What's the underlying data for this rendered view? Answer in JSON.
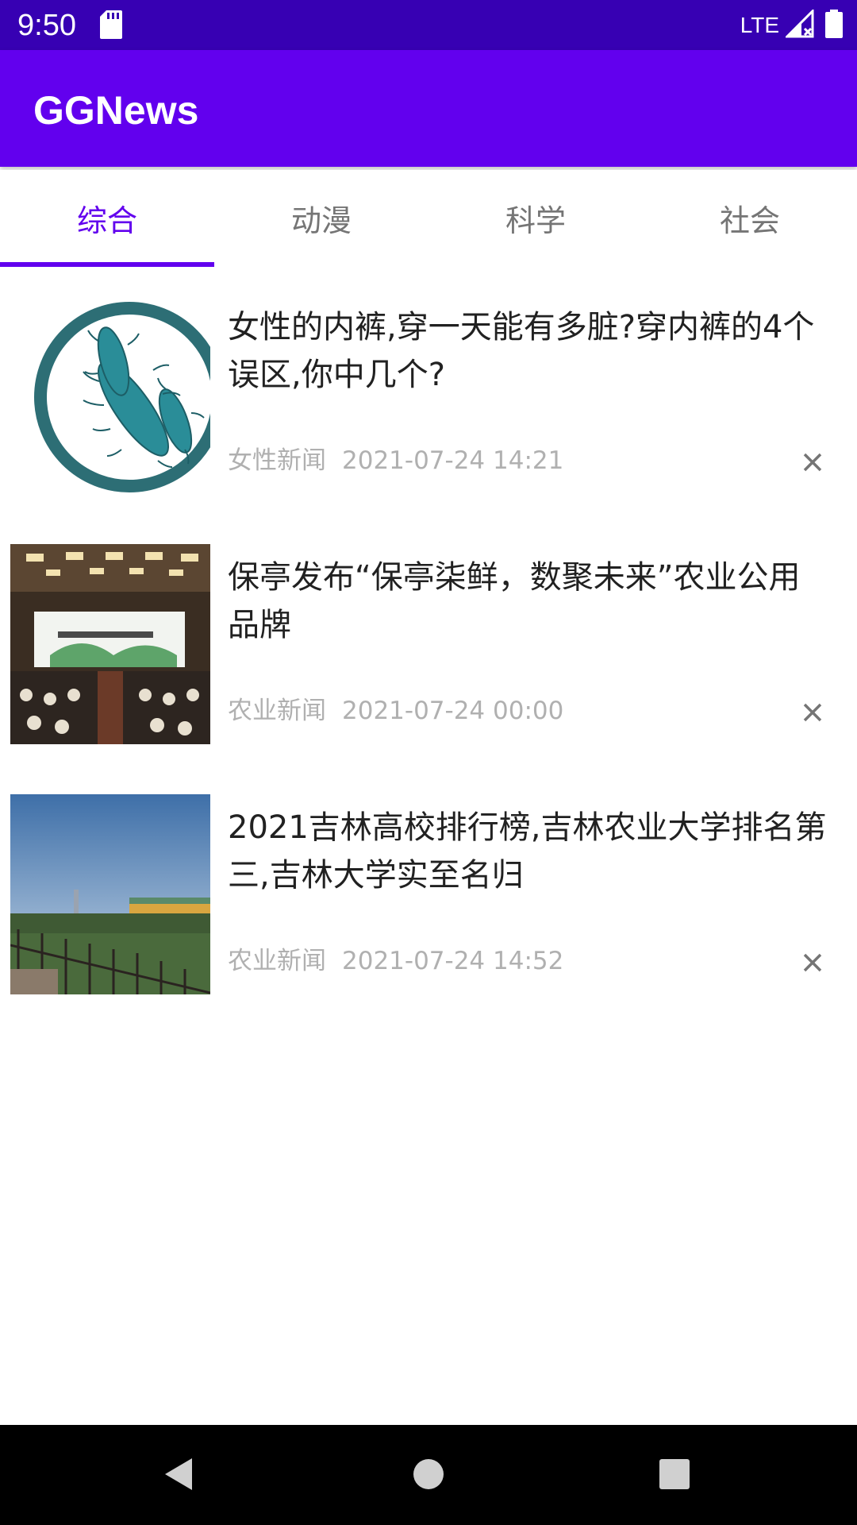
{
  "status_bar": {
    "time": "9:50",
    "network": "LTE",
    "icons": [
      "sd-card-icon",
      "signal-icon",
      "battery-icon"
    ]
  },
  "app_bar": {
    "title": "GGNews"
  },
  "tabs": [
    {
      "label": "综合",
      "active": true
    },
    {
      "label": "动漫",
      "active": false
    },
    {
      "label": "科学",
      "active": false
    },
    {
      "label": "社会",
      "active": false
    }
  ],
  "news": [
    {
      "title": "女性的内裤,穿一天能有多脏?穿内裤的4个误区,你中几个?",
      "source": "女性新闻",
      "time": "2021-07-24 14:21",
      "image": "bacteria-illustration"
    },
    {
      "title": "保亭发布“保亭柒鲜，数聚未来”农业公用品牌",
      "source": "农业新闻",
      "time": "2021-07-24 00:00",
      "image": "conference-hall-photo"
    },
    {
      "title": "2021吉林高校排行榜,吉林农业大学排名第三,吉林大学实至名归",
      "source": "农业新闻",
      "time": "2021-07-24 14:52",
      "image": "campus-photo"
    }
  ],
  "colors": {
    "status_bar": "#3700b3",
    "primary": "#6200ee",
    "tab_inactive": "#757575",
    "meta_text": "#b0b0b0"
  }
}
